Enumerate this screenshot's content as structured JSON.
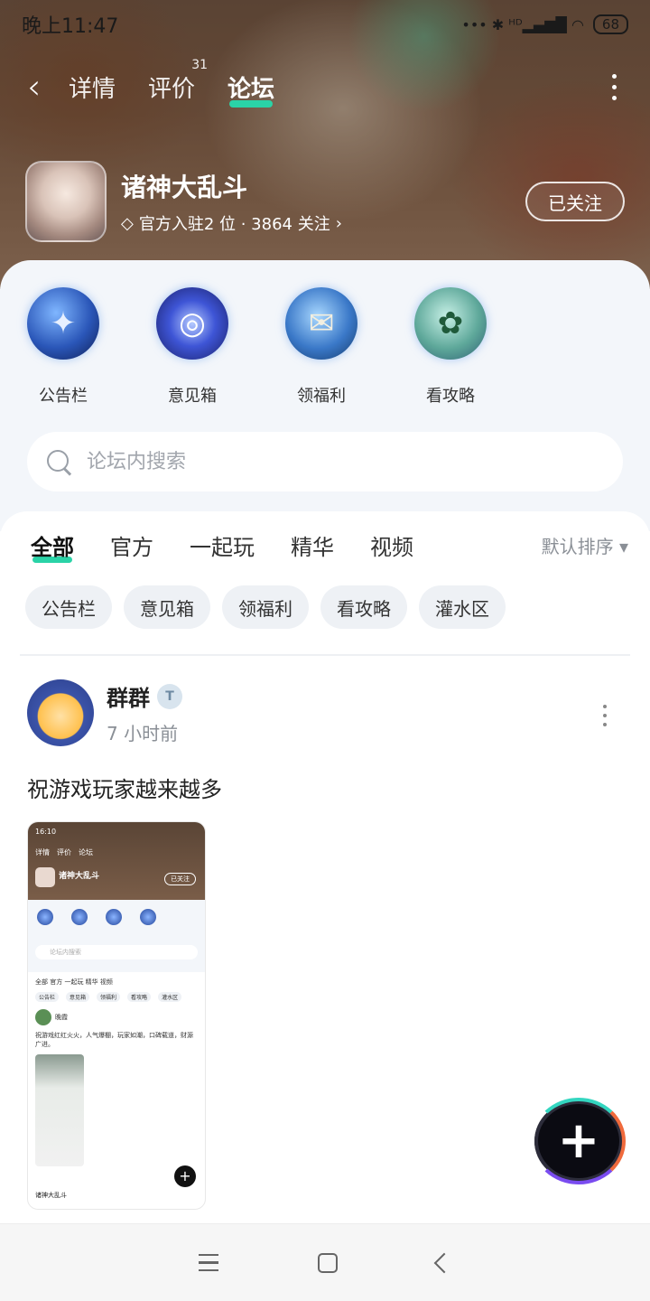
{
  "status_bar": {
    "time": "晚上11:47",
    "network_icons": "•••  ✱ ᴴᴰ▂▄▆█  ◠",
    "battery": "68"
  },
  "nav": {
    "tabs": [
      {
        "label": "详情",
        "active": false
      },
      {
        "label": "评价",
        "count": "31",
        "active": false
      },
      {
        "label": "论坛",
        "active": true
      }
    ]
  },
  "game": {
    "name": "诸神大乱斗",
    "meta": "官方入驻2 位 · 3864 关注",
    "follow_label": "已关注"
  },
  "quick_access": [
    {
      "label": "公告栏",
      "icon": "bulletin-icon",
      "glyph": "✦"
    },
    {
      "label": "意见箱",
      "icon": "galaxy-icon",
      "glyph": "◎"
    },
    {
      "label": "领福利",
      "icon": "scroll-icon",
      "glyph": "✉"
    },
    {
      "label": "看攻略",
      "icon": "leaf-icon",
      "glyph": "✿"
    }
  ],
  "search": {
    "placeholder": "论坛内搜索"
  },
  "feed_tabs": [
    {
      "label": "全部",
      "active": true
    },
    {
      "label": "官方",
      "active": false
    },
    {
      "label": "一起玩",
      "active": false
    },
    {
      "label": "精华",
      "active": false
    },
    {
      "label": "视频",
      "active": false
    }
  ],
  "sort_label": "默认排序 ▾",
  "chips": [
    "公告栏",
    "意见箱",
    "领福利",
    "看攻略",
    "灌水区"
  ],
  "post": {
    "author": "群群",
    "badge": "T",
    "time": "7 小时前",
    "title": "祝游戏玩家越来越多",
    "screenshot": {
      "time": "16:10",
      "tabs": [
        "详情",
        "评价",
        "论坛"
      ],
      "game_name": "诸神大乱斗",
      "follow": "已关注",
      "search": "论坛内搜索",
      "feed_tabs": "全部  官方  一起玩  精华  视频",
      "chips": [
        "公告栏",
        "意见箱",
        "领福利",
        "看攻略",
        "灌水区"
      ],
      "user": "晚霞",
      "text": "祝游戏红红火火，人气爆棚，玩家如潮，口碑载道，财源广进。",
      "footer": "诸神大乱斗"
    }
  },
  "colors": {
    "accent": "#2ad3a7"
  }
}
